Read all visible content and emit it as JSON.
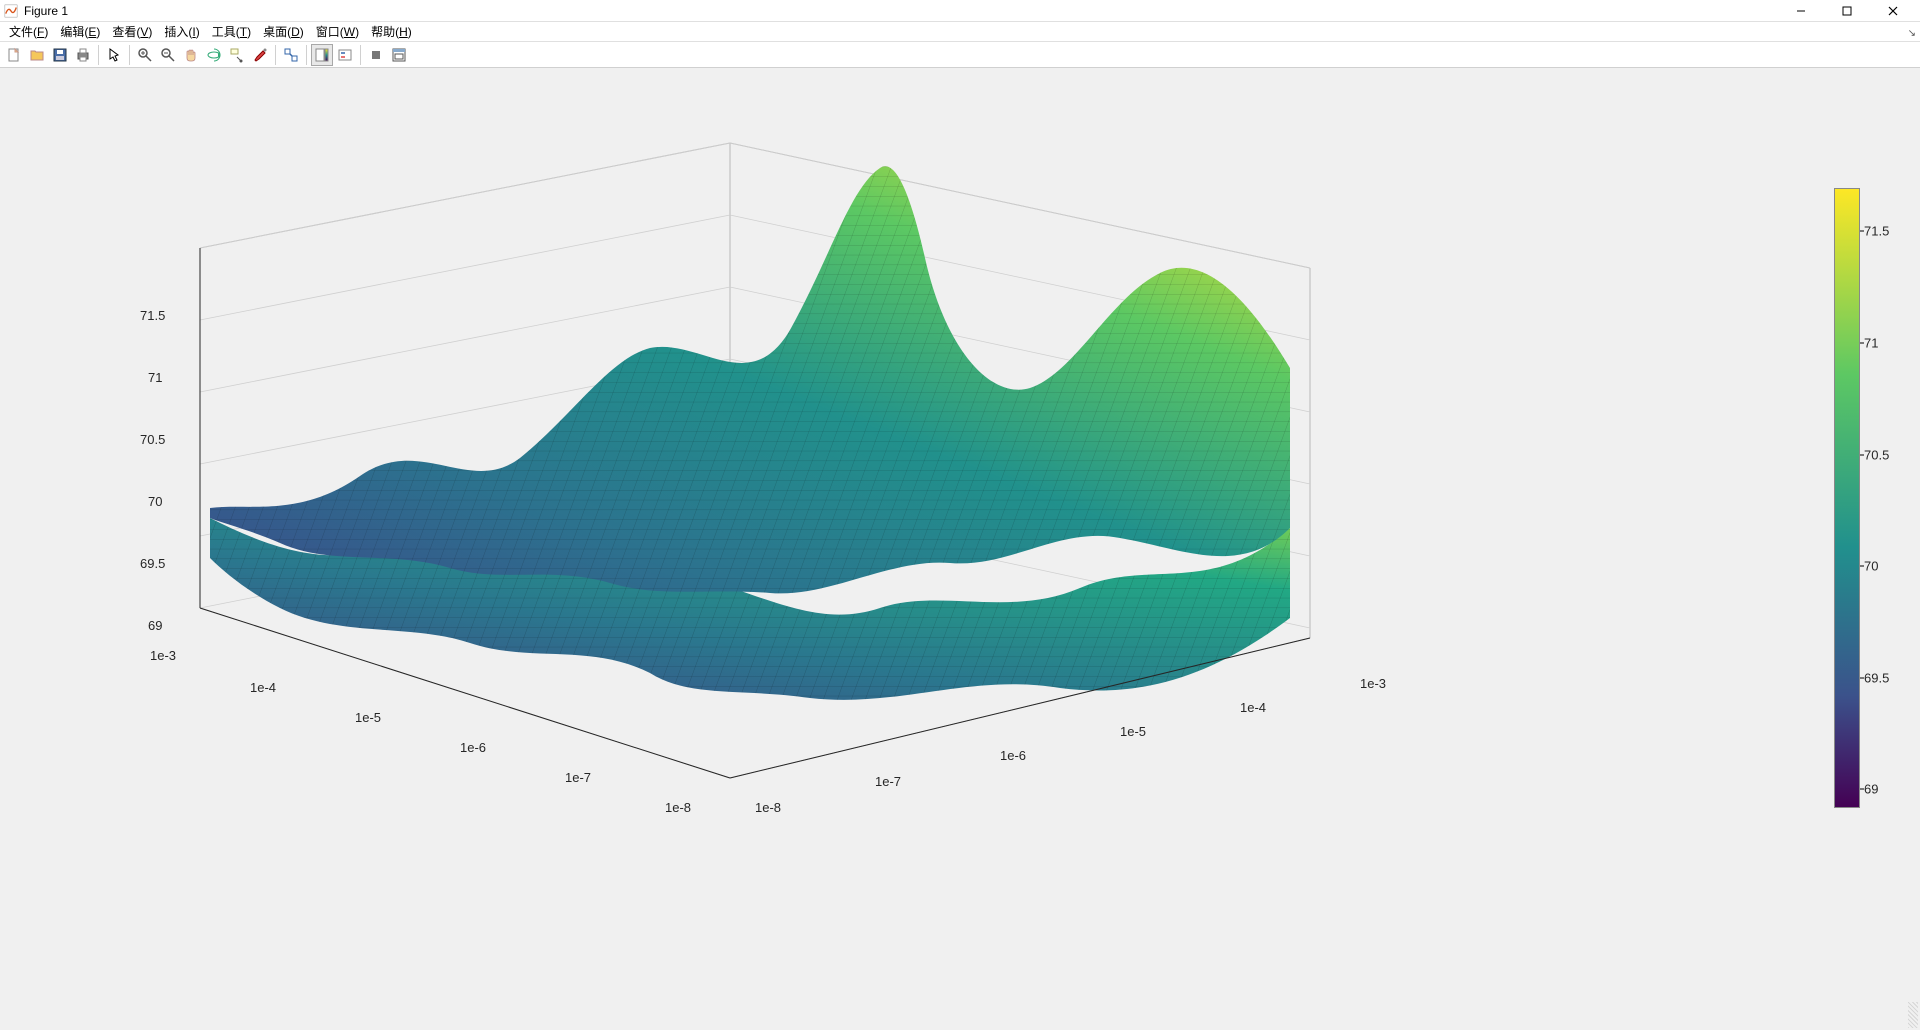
{
  "window": {
    "title": "Figure 1",
    "min_label": "−",
    "max_label": "□",
    "close_label": "×"
  },
  "menu": {
    "file": "文件(F)",
    "edit": "编辑(E)",
    "view": "查看(V)",
    "insert": "插入(I)",
    "tools": "工具(T)",
    "desktop": "桌面(D)",
    "window": "窗口(W)",
    "help": "帮助(H)"
  },
  "toolbar_icons": {
    "new": "new-file-icon",
    "open": "open-folder-icon",
    "save": "save-icon",
    "print": "print-icon",
    "pointer": "pointer-icon",
    "zoom_in": "zoom-in-icon",
    "zoom_out": "zoom-out-icon",
    "pan": "pan-hand-icon",
    "rotate": "rotate-3d-icon",
    "datacursor": "data-cursor-icon",
    "brush": "brush-icon",
    "link": "link-plots-icon",
    "colorbar": "colorbar-icon",
    "legend": "legend-icon",
    "stop": "stop-icon",
    "dock": "dock-figure-icon"
  },
  "chart_data": {
    "type": "surface3d",
    "title": "",
    "xlabel": "",
    "ylabel": "",
    "zlabel": "",
    "x_scale": "log",
    "y_scale": "log",
    "z_scale": "linear",
    "x_ticks": [
      "1e-8",
      "1e-7",
      "1e-6",
      "1e-5",
      "1e-4",
      "1e-3"
    ],
    "y_ticks": [
      "1e-8",
      "1e-7",
      "1e-6",
      "1e-5",
      "1e-4",
      "1e-3"
    ],
    "z_ticks": [
      "69",
      "69.5",
      "70",
      "70.5",
      "71",
      "71.5"
    ],
    "zlim": [
      69,
      71.8
    ],
    "colormap": "parula",
    "colorbar_ticks": [
      "69",
      "69.5",
      "70",
      "70.5",
      "71",
      "71.5"
    ],
    "value_range_approx": {
      "min": 68.9,
      "max": 71.8
    },
    "note": "Two overlapping 3D surfaces over a log-log grid (x,y ∈ [1e-8, 1e-3]); z values approximately between 68.9 and 71.8. Peaks near ~71.8, trough near ~68.9. Surface colored by z using parula colormap."
  }
}
